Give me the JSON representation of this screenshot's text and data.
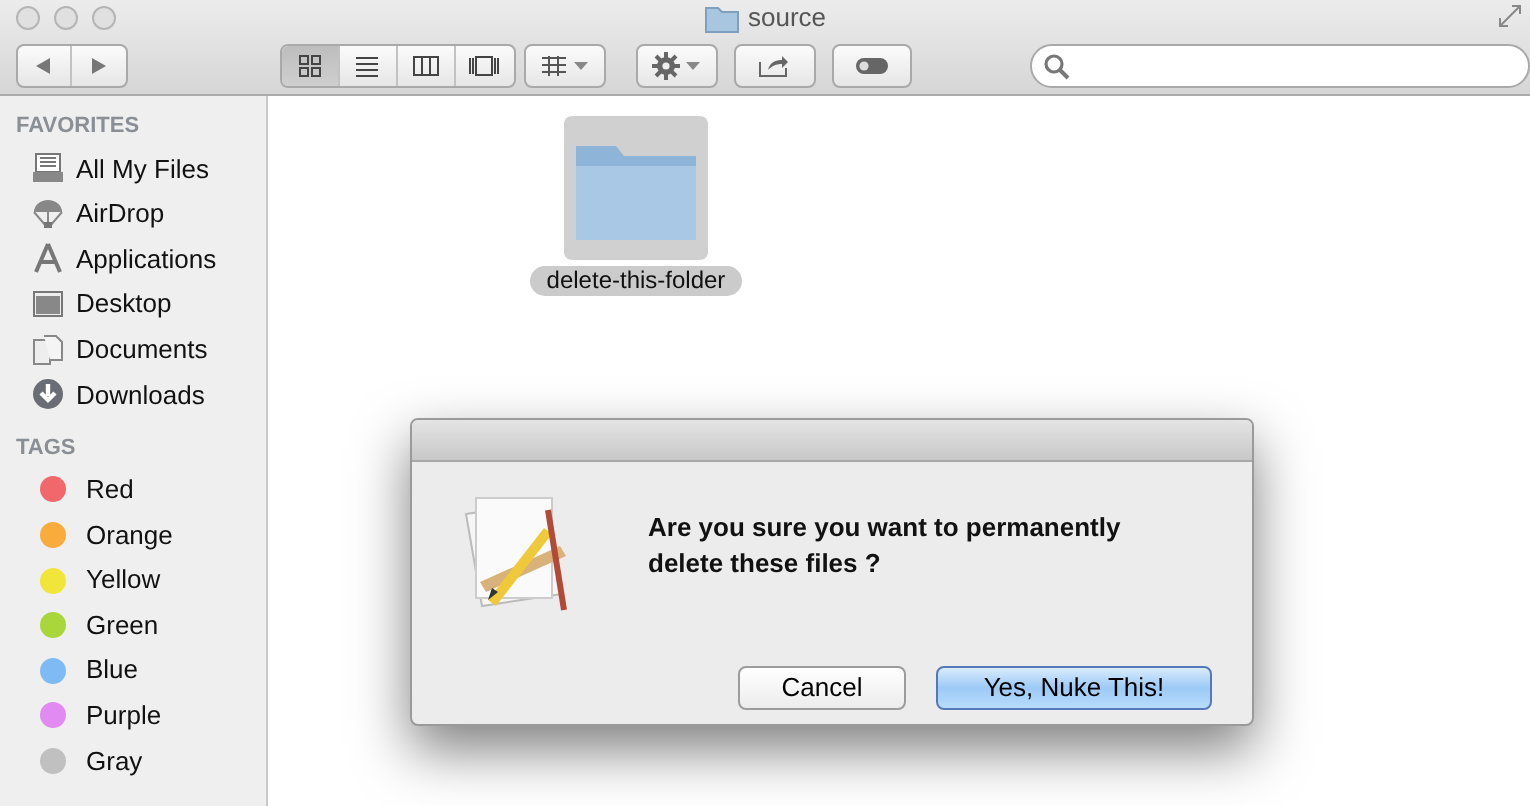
{
  "window": {
    "title": "source"
  },
  "toolbar": {
    "view_buttons": [
      {
        "kind": "icons",
        "selected": true
      },
      {
        "kind": "list",
        "selected": false
      },
      {
        "kind": "columns",
        "selected": false
      },
      {
        "kind": "coverflow",
        "selected": false
      }
    ]
  },
  "sidebar": {
    "sections": [
      {
        "heading": "FAVORITES",
        "items": [
          {
            "label": "All My Files",
            "kind": "files"
          },
          {
            "label": "AirDrop",
            "kind": "airdrop"
          },
          {
            "label": "Applications",
            "kind": "apps"
          },
          {
            "label": "Desktop",
            "kind": "desktop"
          },
          {
            "label": "Documents",
            "kind": "documents"
          },
          {
            "label": "Downloads",
            "kind": "downloads"
          }
        ]
      },
      {
        "heading": "TAGS",
        "items": [
          {
            "label": "Red",
            "kind": "tag",
            "color": "#f2676c"
          },
          {
            "label": "Orange",
            "kind": "tag",
            "color": "#f9ab3b"
          },
          {
            "label": "Yellow",
            "kind": "tag",
            "color": "#f2e53a"
          },
          {
            "label": "Green",
            "kind": "tag",
            "color": "#a8d63b"
          },
          {
            "label": "Blue",
            "kind": "tag",
            "color": "#7fbaf5"
          },
          {
            "label": "Purple",
            "kind": "tag",
            "color": "#e08af2"
          },
          {
            "label": "Gray",
            "kind": "tag",
            "color": "#c0c0c0"
          }
        ]
      }
    ]
  },
  "files": [
    {
      "name": "delete-this-folder",
      "selected": true
    }
  ],
  "dialog": {
    "message": "Are you sure you want to permanently delete these files ?",
    "buttons": [
      {
        "label": "Cancel",
        "default": false
      },
      {
        "label": "Yes, Nuke This!",
        "default": true
      }
    ]
  }
}
